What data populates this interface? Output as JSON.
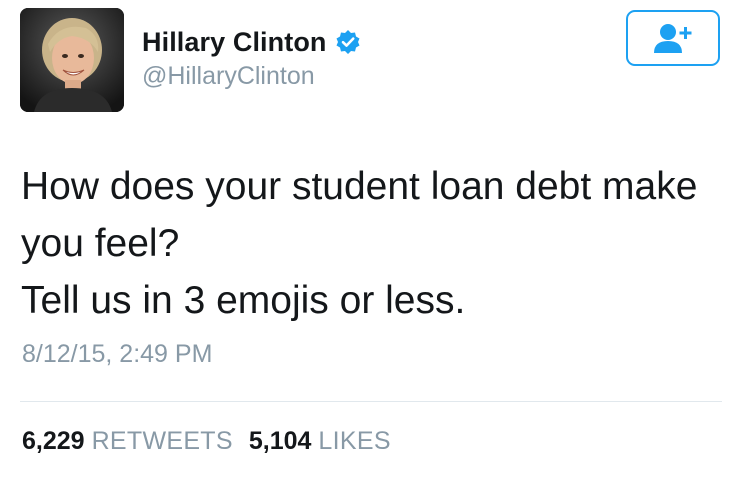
{
  "author": {
    "name": "Hillary Clinton",
    "handle": "@HillaryClinton",
    "verified": true
  },
  "follow_button": {
    "icon": "follow-user-icon"
  },
  "tweet": {
    "lines": [
      "How does your student loan debt make",
      "you feel?",
      "Tell us in 3 emojis or less."
    ],
    "timestamp": "8/12/15, 2:49 PM"
  },
  "stats": {
    "retweets": {
      "count": "6,229",
      "label": "RETWEETS"
    },
    "likes": {
      "count": "5,104",
      "label": "LIKES"
    }
  },
  "colors": {
    "accent": "#1da1f2",
    "text": "#14171a",
    "muted": "#8899a6",
    "divider": "#e1e8ed"
  }
}
